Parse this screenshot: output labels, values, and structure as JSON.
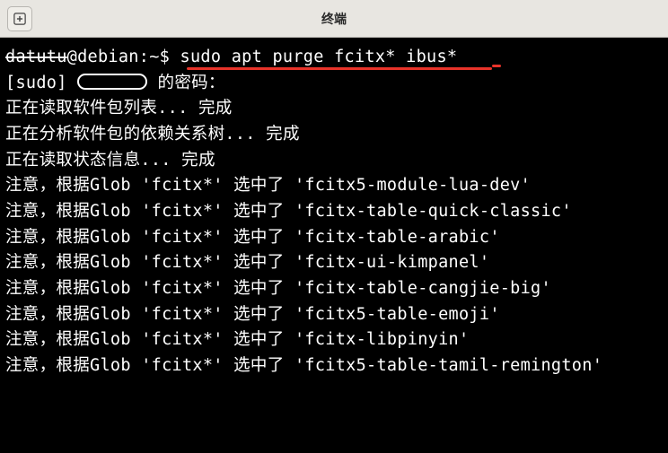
{
  "window": {
    "title": "终端"
  },
  "prompt": {
    "user_masked": "datutu",
    "host": "debian",
    "path": "~",
    "command": "sudo apt purge fcitx* ibus*"
  },
  "sudo_line": {
    "prefix": "[sudo] ",
    "suffix": " 的密码："
  },
  "progress": [
    "正在读取软件包列表... 完成",
    "正在分析软件包的依赖关系树... 完成",
    "正在读取状态信息... 完成"
  ],
  "notice_prefix": "注意，根据Glob 'fcitx*' 选中了 '",
  "notice_suffix": "'",
  "selections": [
    "fcitx5-module-lua-dev",
    "fcitx-table-quick-classic",
    "fcitx-table-arabic",
    "fcitx-ui-kimpanel",
    "fcitx-table-cangjie-big",
    "fcitx5-table-emoji",
    "fcitx-libpinyin",
    "fcitx5-table-tamil-remington"
  ]
}
